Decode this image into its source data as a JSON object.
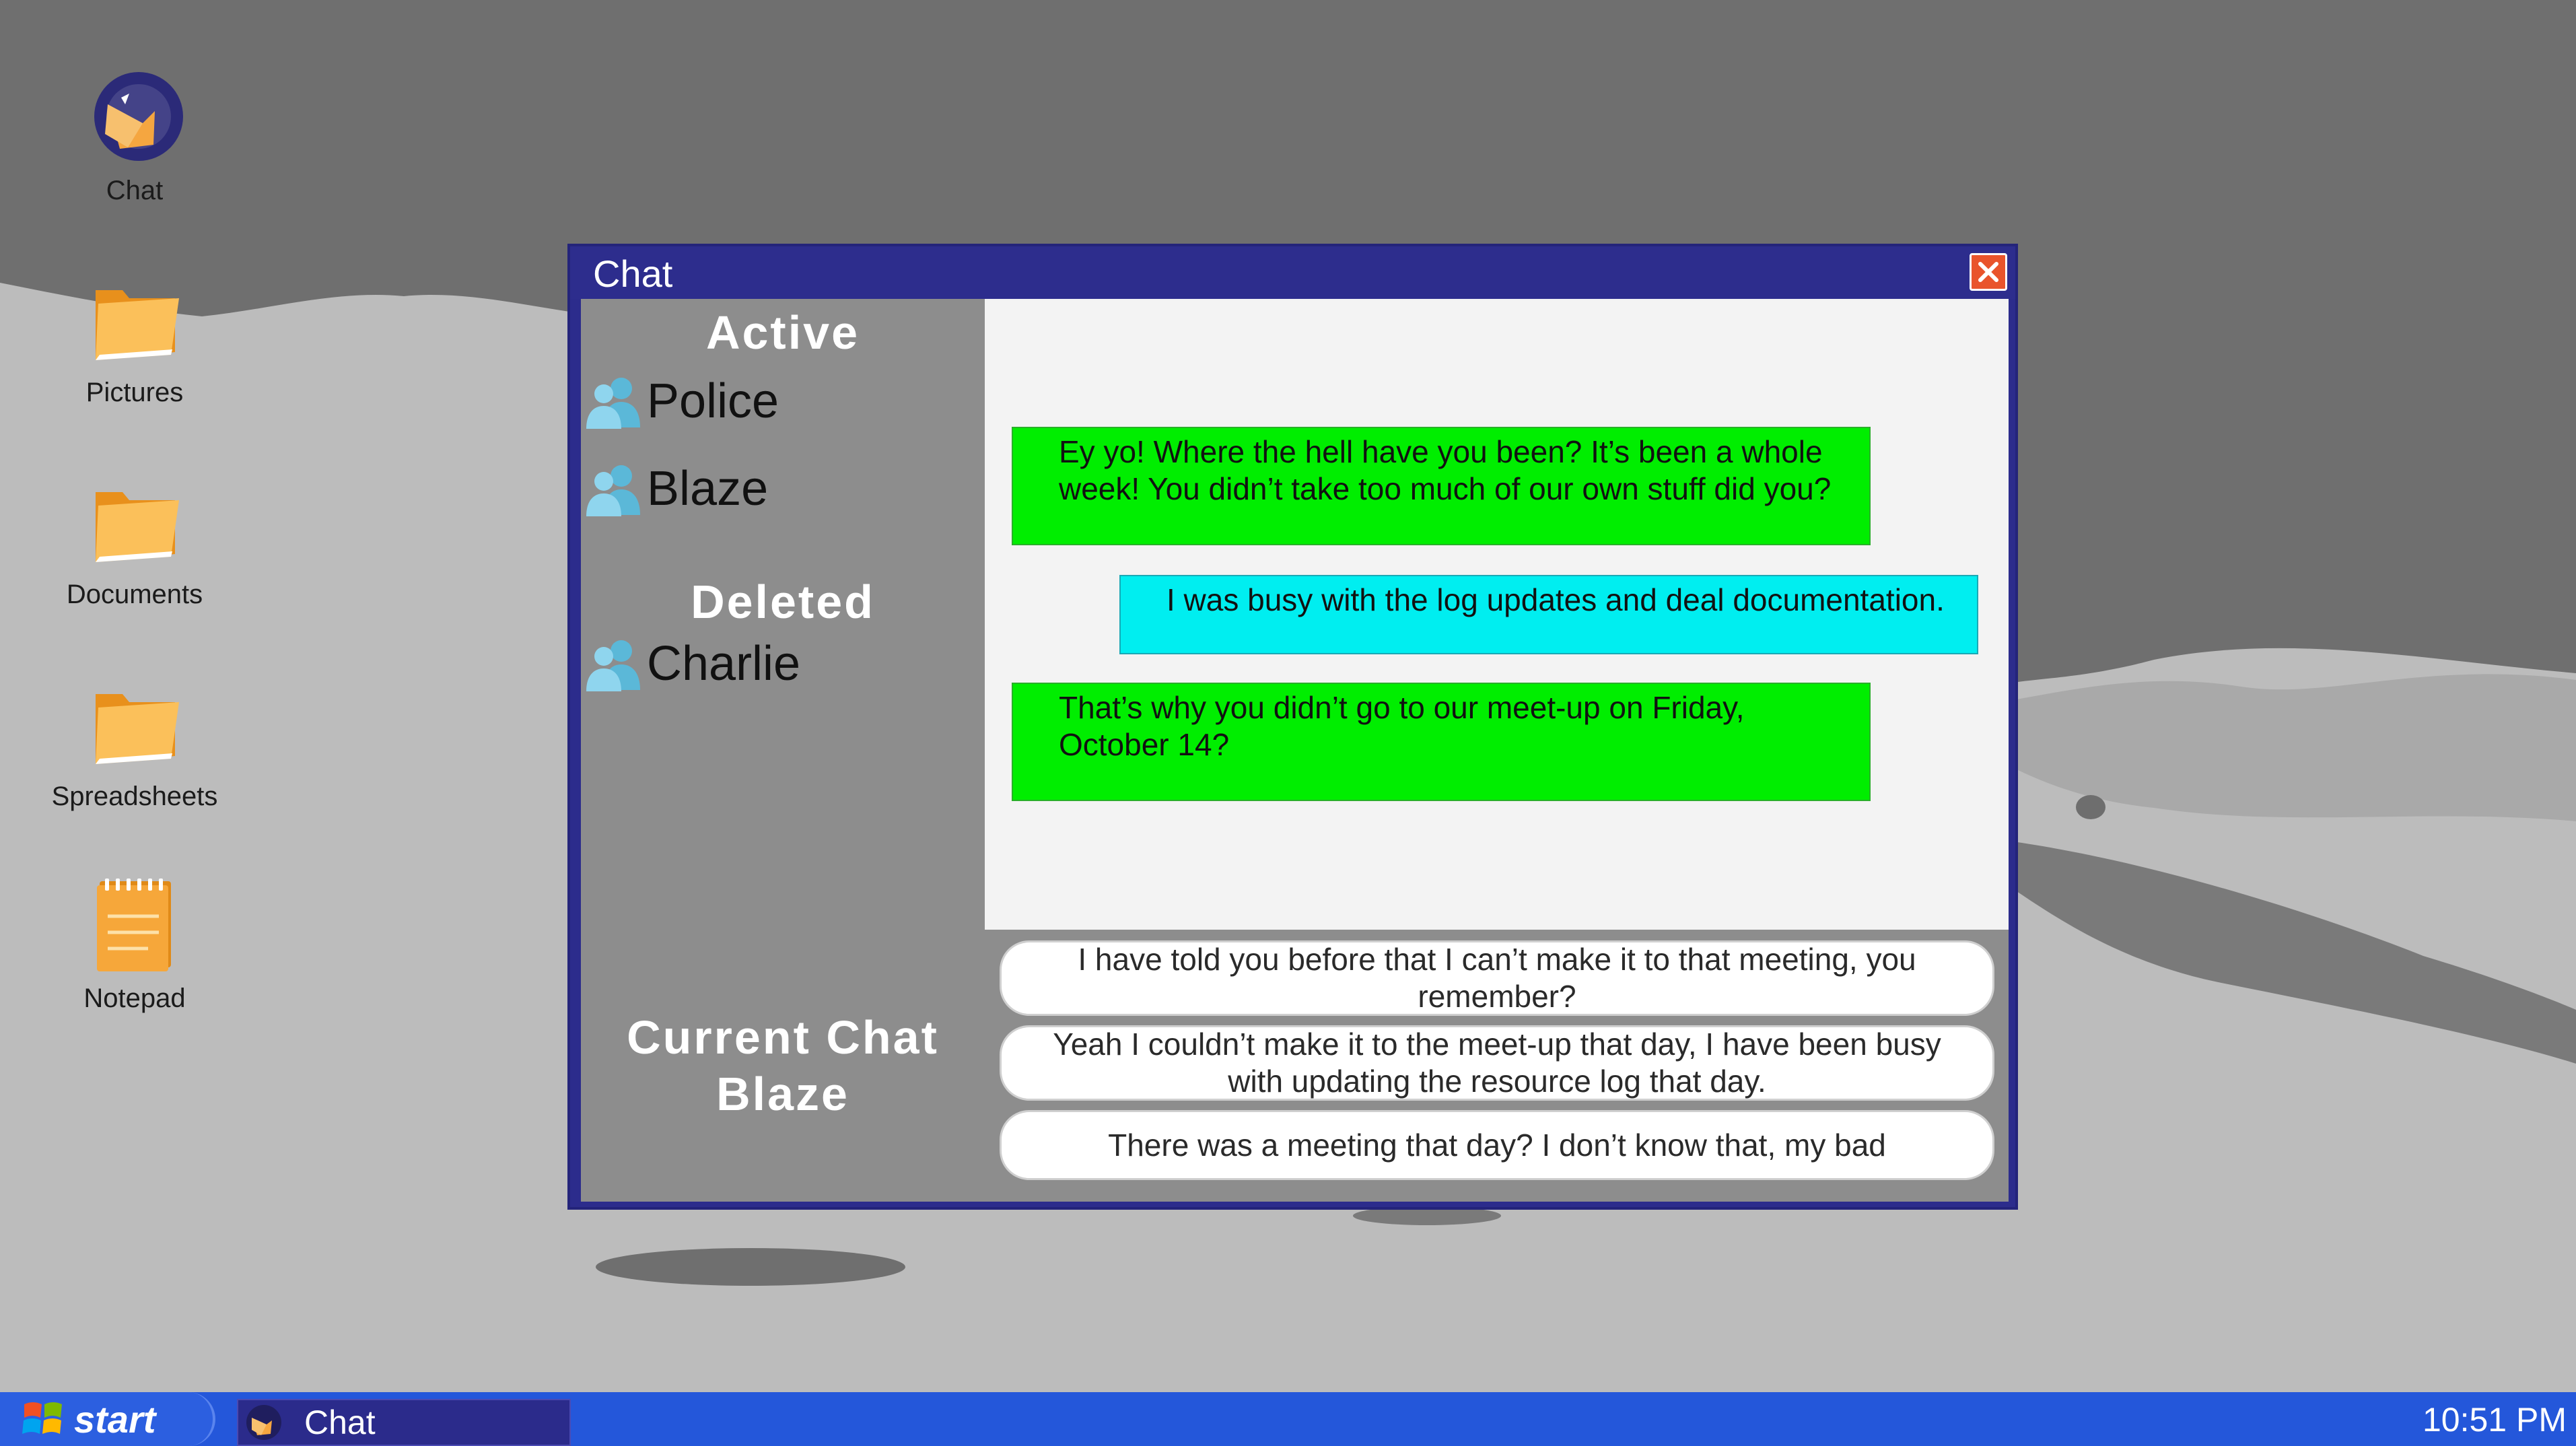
{
  "desktop": {
    "icons": [
      {
        "label": "Chat",
        "icon": "chat-app-icon"
      },
      {
        "label": "Pictures",
        "icon": "folder-icon"
      },
      {
        "label": "Documents",
        "icon": "folder-icon"
      },
      {
        "label": "Spreadsheets",
        "icon": "folder-icon"
      },
      {
        "label": "Notepad",
        "icon": "notepad-icon"
      }
    ]
  },
  "window": {
    "title": "Chat",
    "close_icon": "close-icon",
    "sidebar": {
      "active_heading": "Active",
      "active_contacts": [
        "Police",
        "Blaze"
      ],
      "deleted_heading": "Deleted",
      "deleted_contacts": [
        "Charlie"
      ],
      "current_chat_label": "Current Chat",
      "current_chat_name": "Blaze"
    },
    "messages": [
      {
        "from": "them",
        "text": "Ey yo! Where the hell have you been? It’s been a whole week! You didn’t take too much of our own stuff did you?"
      },
      {
        "from": "me",
        "text": "I was busy with the log updates and deal documentation."
      },
      {
        "from": "them",
        "text": "That’s why you didn’t go to our meet-up on Friday, October 14?"
      }
    ],
    "replies": [
      "I have told you before that I can’t make it to that meeting, you remember?",
      "Yeah I couldn’t make it to the meet-up that day, I have been busy with updating the resource log that day.",
      "There was a meeting that day? I don’t know that, my bad"
    ]
  },
  "taskbar": {
    "start_label": "start",
    "task_label": "Chat",
    "clock": "10:51 PM"
  },
  "colors": {
    "window_frame": "#2c2c8c",
    "incoming_bubble": "#00ee00",
    "outgoing_bubble": "#00eef0",
    "taskbar": "#2457da",
    "close_button": "#e9542c"
  }
}
